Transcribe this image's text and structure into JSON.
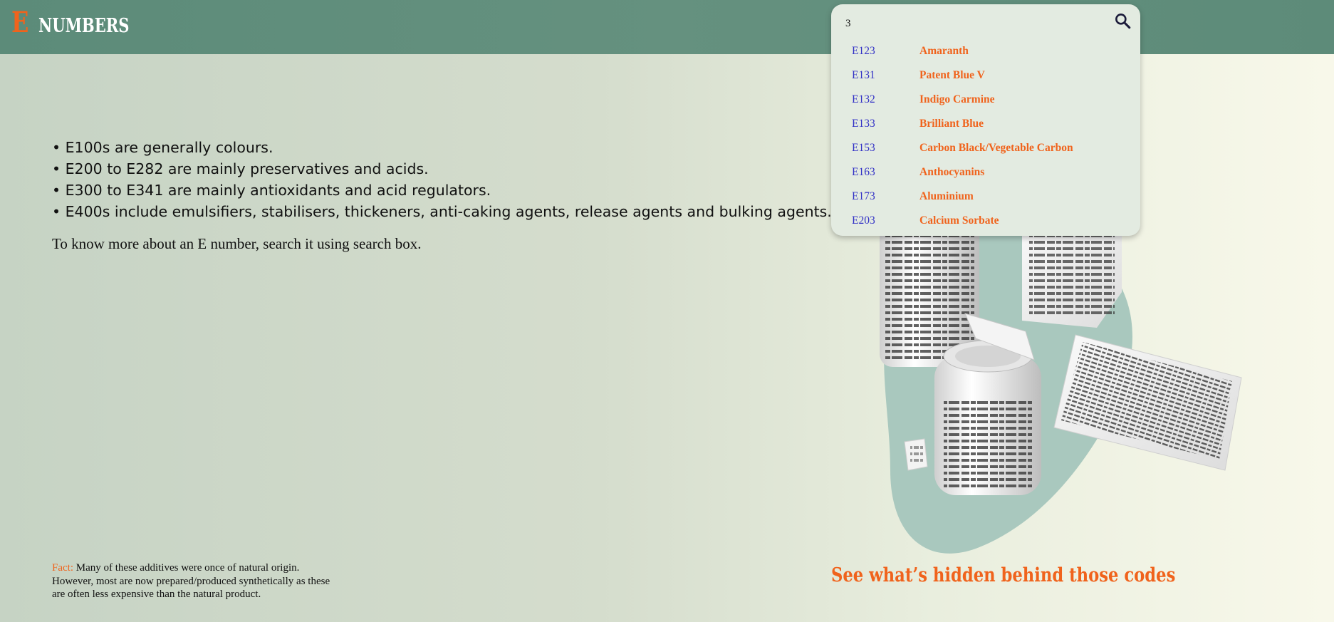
{
  "header": {
    "logo_letter": "E",
    "logo_text": "NUMBERS"
  },
  "intro": {
    "bullets": [
      "E100s are generally colours.",
      "E200 to E282 are mainly preservatives and acids.",
      "E300 to E341 are mainly antioxidants and acid regulators.",
      "E400s include emulsifiers, stabilisers, thickeners, anti-caking agents, release agents and bulking agents."
    ],
    "search_hint": "To know more about an E number, search it using search box."
  },
  "fact": {
    "label": "Fact:",
    "text": "Many of these additives were once of natural origin. However, most are now prepared/produced synthetically as these are often less expensive than the natural product."
  },
  "tagline": "See what’s hidden behind those codes",
  "search": {
    "value": "3",
    "icon": "search-icon",
    "results": [
      {
        "code": "E123",
        "name": "Amaranth"
      },
      {
        "code": "E131",
        "name": "Patent Blue V"
      },
      {
        "code": "E132",
        "name": "Indigo Carmine"
      },
      {
        "code": "E133",
        "name": "Brilliant Blue"
      },
      {
        "code": "E153",
        "name": "Carbon Black/Vegetable Carbon"
      },
      {
        "code": "E163",
        "name": "Anthocyanins"
      },
      {
        "code": "E173",
        "name": "Aluminium"
      },
      {
        "code": "E203",
        "name": "Calcium Sorbate"
      }
    ]
  },
  "illustration": {
    "label_text": "INGREDIENTS: ENRICHED FLOUR (WHEAT FLOUR, NIACIN, REDUCED IRON, THIAMIN MONONITRATE, RIBOFLAVIN, FOLIC ACID), SUGAR, SOYBEAN AND PALM OIL, CORN SYRUP SOLIDS, GLYCERIN, CONTAINS 2% OR LESS OF DEXTROSE, MODIFIED CORN STARCH, SALT, POLYDEXTROSE, LECITHIN, CARNAUBA WAX, XANTHAN GUM, VITAMIN A PALMITATE, YELLOW #5, RED #40, BLUE #2, CITRIC ACID",
    "colors": {
      "blob": "#a9c8be",
      "box": "#f2f2f2",
      "text": "#2a2a2a"
    }
  },
  "colors": {
    "accent": "#f0631c",
    "header": "#62907d",
    "code": "#3231c6"
  }
}
